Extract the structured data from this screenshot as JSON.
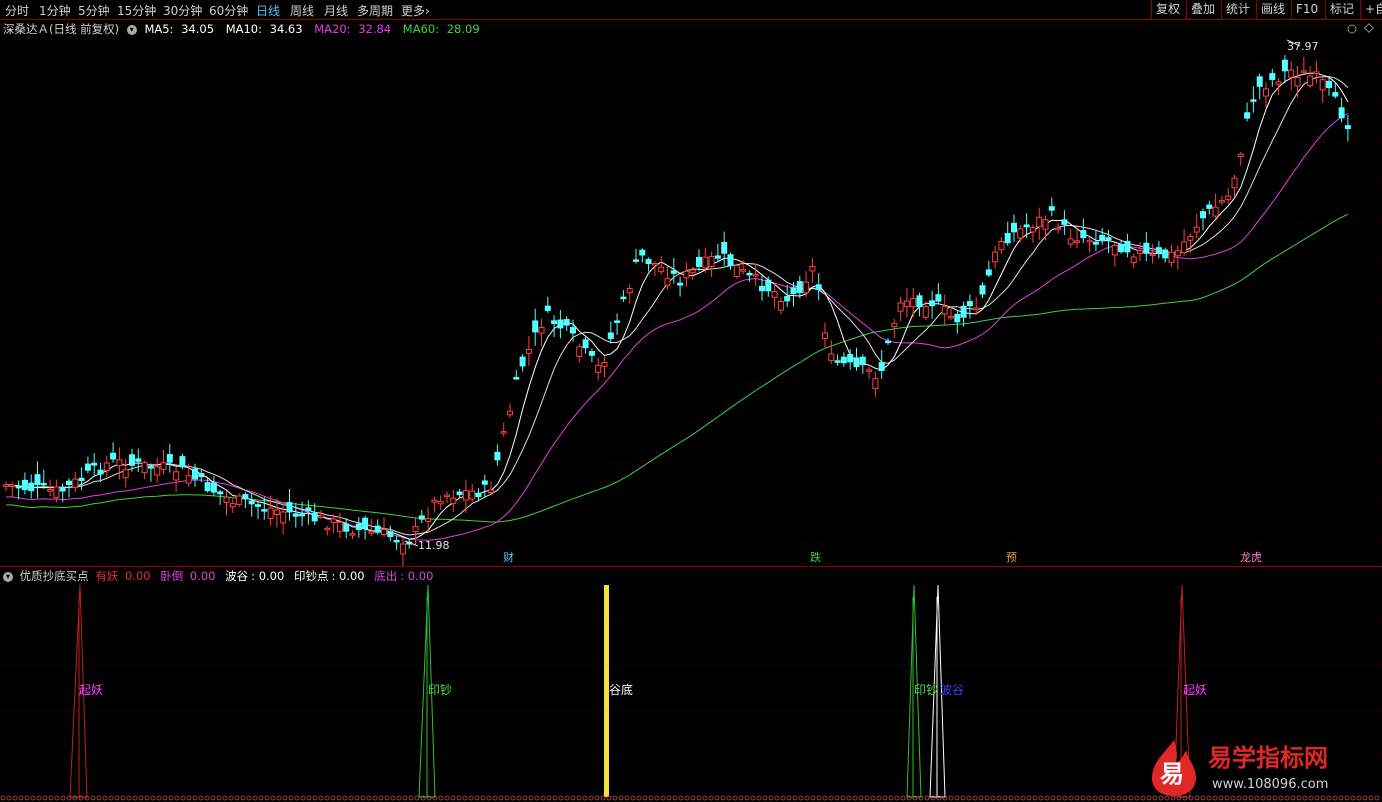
{
  "toolbar": {
    "timeframes": [
      "分时",
      "1分钟",
      "5分钟",
      "15分钟",
      "30分钟",
      "60分钟",
      "日线",
      "周线",
      "月线",
      "多周期",
      "更多"
    ],
    "active": "日线",
    "more_arrow": "›",
    "right_buttons": [
      "复权",
      "叠加",
      "统计",
      "画线",
      "F10",
      "标记",
      "+自"
    ]
  },
  "main_chart": {
    "stock": "深桑达Ａ",
    "mode": "(日线 前复权)",
    "ma": [
      {
        "label": "MA5:",
        "value": "34.05",
        "color": "#ffffff"
      },
      {
        "label": "MA10:",
        "value": "34.63",
        "color": "#ffffff"
      },
      {
        "label": "MA20:",
        "value": "32.84",
        "color": "#e040e0"
      },
      {
        "label": "MA60:",
        "value": "28.09",
        "color": "#40d040"
      }
    ],
    "high_label": "37.97",
    "low_label": "11.98",
    "event_markers": [
      {
        "text": "财",
        "color": "#4fc3ff"
      },
      {
        "text": "跌",
        "color": "#40d040"
      },
      {
        "text": "预",
        "color": "#e0a040"
      },
      {
        "text": "龙虎",
        "color": "#ff80c0"
      }
    ]
  },
  "indicator": {
    "name": "优质抄底买点",
    "values": [
      {
        "label": "有妖",
        "value": "0.00",
        "color": "#e03030"
      },
      {
        "label": "卧倒",
        "value": "0.00",
        "color": "#e040e0"
      },
      {
        "label": "波谷",
        "value": "0.00",
        "color": "#ffffff"
      },
      {
        "label": "印钞点",
        "value": "0.00",
        "color": "#ffffff"
      },
      {
        "label": "底出",
        "value": "0.00",
        "color": "#e040e0"
      }
    ],
    "signals": [
      {
        "text": "起妖",
        "color": "#ff40ff"
      },
      {
        "text": "印钞",
        "color": "#40e040"
      },
      {
        "text": "谷底",
        "color": "#ffffff"
      },
      {
        "text": "印钞",
        "color": "#40e040"
      },
      {
        "text": "波谷",
        "color": "#4040ff"
      },
      {
        "text": "起妖",
        "color": "#ff40ff"
      }
    ]
  },
  "watermark": {
    "logo_char": "易",
    "title": "易学指标网",
    "url": "www.108096.com"
  },
  "colors": {
    "up": "#ff4040",
    "down": "#54ffff",
    "ma5": "#ffffff",
    "ma20": "#e040e0",
    "ma60": "#40d040"
  }
}
